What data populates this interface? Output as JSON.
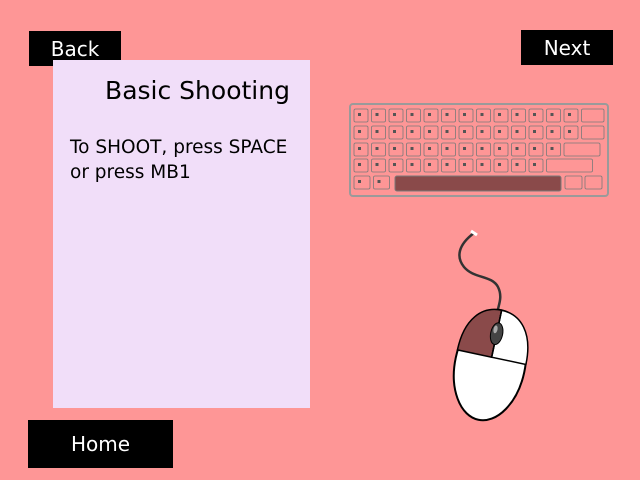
{
  "screen": {
    "background": "#fe9696",
    "panel_background": "#f1def9",
    "button_background": "#000000",
    "button_text_color": "#ffffff",
    "highlight_color": "#8a4a4a"
  },
  "nav": {
    "back_label": "Back",
    "next_label": "Next",
    "home_label": "Home"
  },
  "tutorial": {
    "title": "Basic Shooting",
    "line_1": "To SHOOT, press SPACE",
    "line_2": "or press MB1"
  },
  "illustrations": {
    "keyboard": {
      "icon": "keyboard-icon",
      "highlighted_key": "space-key"
    },
    "mouse": {
      "icon": "mouse-icon",
      "highlighted_button": "left-mouse-button"
    }
  }
}
